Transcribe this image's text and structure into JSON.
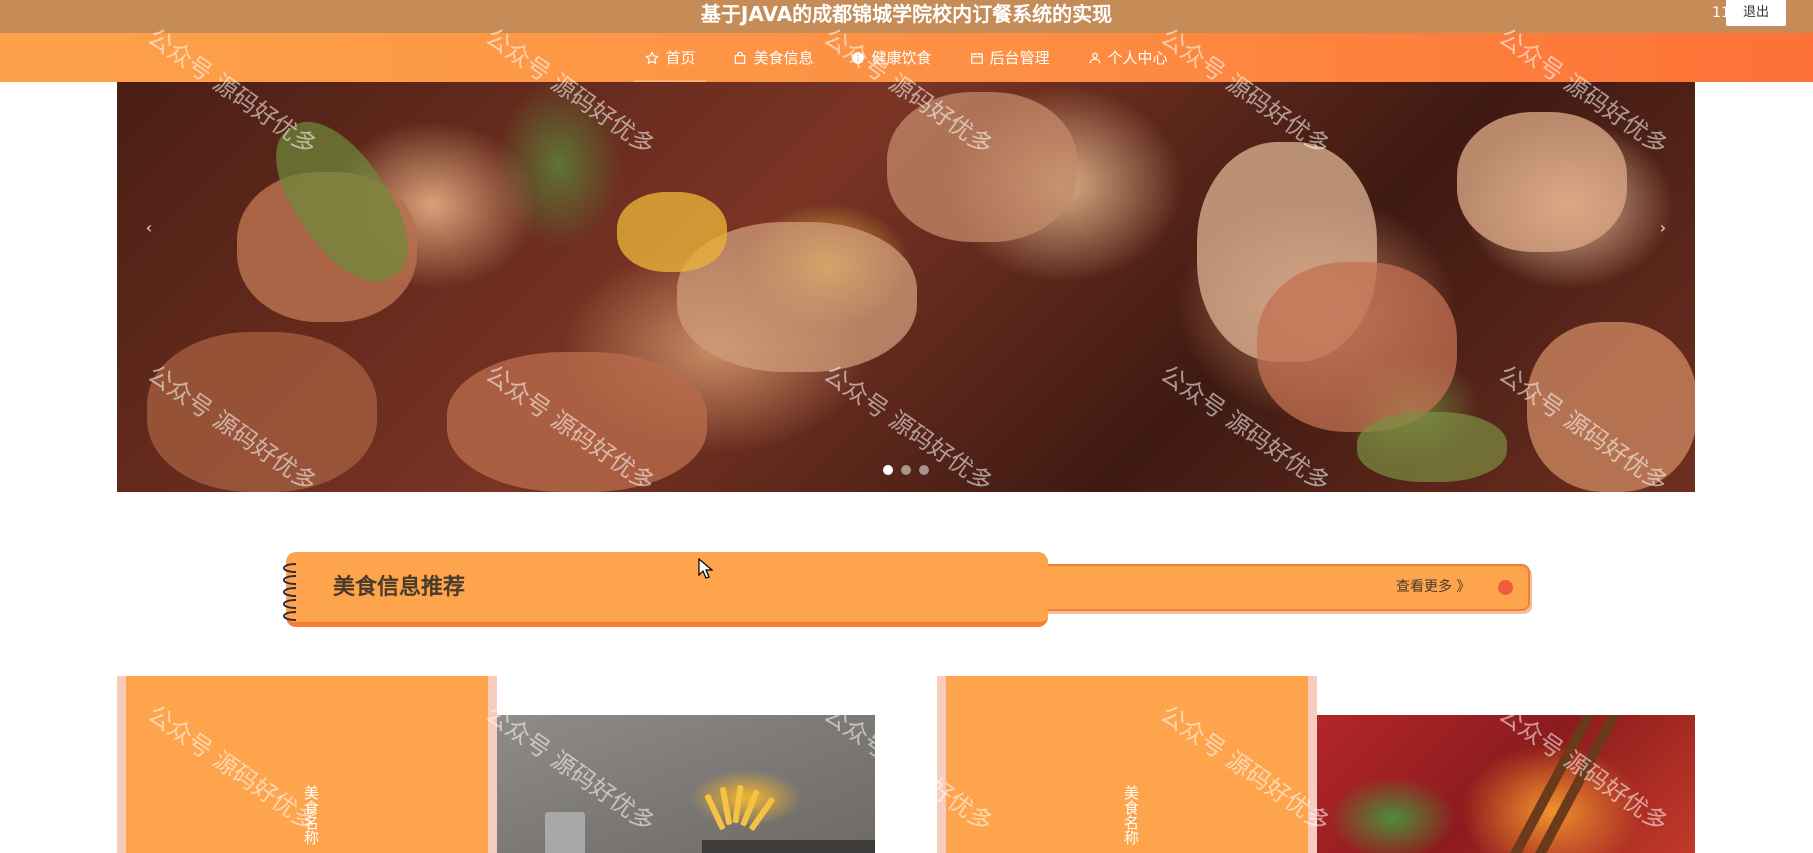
{
  "header": {
    "site_title": "基于JAVA的成都锦城学院校内订餐系统的实现",
    "user_name": "11",
    "logout_label": "退出"
  },
  "nav": {
    "items": [
      {
        "label": "首页",
        "icon": "star-icon",
        "active": true
      },
      {
        "label": "美食信息",
        "icon": "bag-icon",
        "active": false
      },
      {
        "label": "健康饮食",
        "icon": "info-icon",
        "active": false
      },
      {
        "label": "后台管理",
        "icon": "calendar-icon",
        "active": false
      },
      {
        "label": "个人中心",
        "icon": "user-icon",
        "active": false
      }
    ]
  },
  "banner": {
    "prev_arrow": "‹",
    "next_arrow": "›",
    "dot_count": 3,
    "active_dot": 1
  },
  "section": {
    "title": "美食信息推荐",
    "more_label": "查看更多 》"
  },
  "cards": [
    {
      "name": "美食名称"
    },
    {
      "name": "美食名称"
    }
  ],
  "watermark": "公众号 源码好优多",
  "colors": {
    "topbar": "#c58c57",
    "nav_gradient_start": "#fda24a",
    "nav_gradient_end": "#fd7136",
    "card_orange": "#fea44c",
    "card_border": "#f7ccbd",
    "accent_red": "#f15c3c"
  }
}
